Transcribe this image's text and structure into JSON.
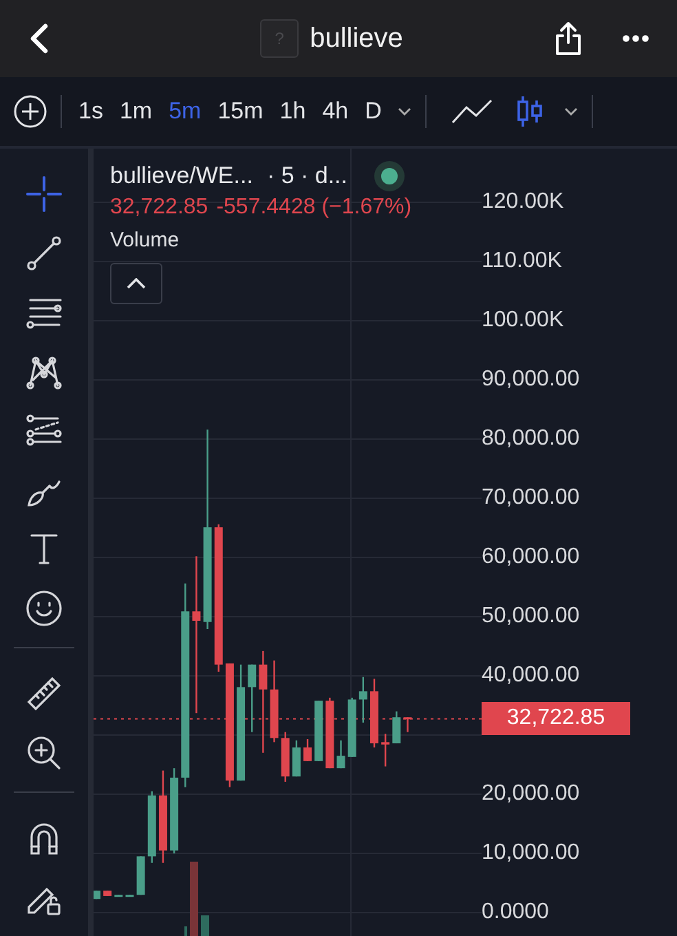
{
  "header": {
    "token_logo_text": "?",
    "title": "bullieve"
  },
  "toolbar": {
    "intervals": [
      {
        "label": "1s",
        "selected": false
      },
      {
        "label": "1m",
        "selected": false
      },
      {
        "label": "5m",
        "selected": true
      },
      {
        "label": "15m",
        "selected": false
      },
      {
        "label": "1h",
        "selected": false
      },
      {
        "label": "4h",
        "selected": false
      },
      {
        "label": "D",
        "selected": false
      }
    ],
    "chart_types": [
      {
        "kind": "line",
        "selected": false
      },
      {
        "kind": "candles",
        "selected": true
      }
    ]
  },
  "tools": [
    {
      "kind": "crosshair",
      "selected": true
    },
    {
      "kind": "trend-line",
      "selected": false
    },
    {
      "kind": "fib",
      "selected": false
    },
    {
      "kind": "pattern",
      "selected": false
    },
    {
      "kind": "channel",
      "selected": false
    },
    {
      "kind": "brush",
      "selected": false
    },
    {
      "kind": "text",
      "selected": false
    },
    {
      "kind": "emoji",
      "selected": false
    },
    {
      "kind": "divider"
    },
    {
      "kind": "ruler",
      "selected": false
    },
    {
      "kind": "zoom",
      "selected": false
    },
    {
      "kind": "divider"
    },
    {
      "kind": "magnet",
      "selected": false
    },
    {
      "kind": "lock-draw",
      "selected": false
    }
  ],
  "legend": {
    "symbol": "bullieve/WE...",
    "interval": "· 5 · d...",
    "price": "32,722.85",
    "change": "-557.4428 (−1.67%)",
    "indicator": "Volume"
  },
  "chart_data": {
    "type": "candlestick",
    "ohlc": [
      [
        2300,
        3700,
        2300,
        3700
      ],
      [
        3700,
        3700,
        2800,
        2800
      ],
      [
        2800,
        3000,
        2800,
        3000
      ],
      [
        2800,
        3000,
        2800,
        3000
      ],
      [
        3000,
        9500,
        3000,
        9500
      ],
      [
        9500,
        20500,
        8400,
        19800
      ],
      [
        19800,
        24000,
        8400,
        10500
      ],
      [
        10500,
        24400,
        10000,
        22800
      ],
      [
        22800,
        55600,
        21200,
        50900
      ],
      [
        50900,
        60200,
        33700,
        49300
      ],
      [
        49100,
        81600,
        47900,
        65100
      ],
      [
        65100,
        65600,
        40700,
        41900
      ],
      [
        42100,
        42100,
        21200,
        22300
      ],
      [
        22300,
        41900,
        22300,
        38100
      ],
      [
        38100,
        41900,
        30500,
        41900
      ],
      [
        41900,
        44200,
        27000,
        37700
      ],
      [
        37700,
        42600,
        28800,
        29500
      ],
      [
        29500,
        30500,
        22100,
        23000
      ],
      [
        23000,
        29100,
        23000,
        27900
      ],
      [
        27900,
        29300,
        25600,
        25600
      ],
      [
        25600,
        35800,
        25600,
        35800
      ],
      [
        35800,
        36300,
        24400,
        24400
      ],
      [
        24400,
        29100,
        24400,
        26500
      ],
      [
        26300,
        36300,
        26300,
        36000
      ],
      [
        36000,
        39800,
        32100,
        37400
      ],
      [
        37400,
        39500,
        27900,
        28600
      ],
      [
        28800,
        30200,
        24700,
        28400
      ],
      [
        28600,
        34000,
        28600,
        33000
      ],
      [
        33000,
        33000,
        30500,
        32722.85
      ]
    ],
    "grid": true,
    "ref_lines": [
      {
        "axis": "y",
        "value": 32722.85,
        "label": "32,722.85",
        "color": "#e0464e"
      }
    ],
    "ylim": [
      0,
      120000
    ],
    "yticks": [
      {
        "value": 120000,
        "label": "120.00K"
      },
      {
        "value": 110000,
        "label": "110.00K"
      },
      {
        "value": 100000,
        "label": "100.00K"
      },
      {
        "value": 90000,
        "label": "90,000.00"
      },
      {
        "value": 80000,
        "label": "80,000.00"
      },
      {
        "value": 70000,
        "label": "70,000.00"
      },
      {
        "value": 60000,
        "label": "60,000.00"
      },
      {
        "value": 50000,
        "label": "50,000.00"
      },
      {
        "value": 40000,
        "label": "40,000.00"
      },
      {
        "value": 20000,
        "label": "20,000.00"
      },
      {
        "value": 10000,
        "label": "10,000.00"
      },
      {
        "value": 0,
        "label": "0.0000"
      }
    ]
  }
}
